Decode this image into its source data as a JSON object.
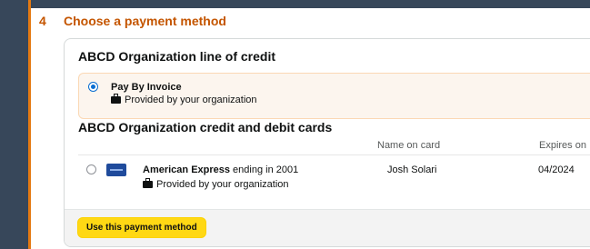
{
  "step": {
    "number": "4",
    "title": "Choose a payment method"
  },
  "line_of_credit": {
    "title": "ABCD Organization line of credit",
    "option_label": "Pay By Invoice",
    "provided_text": "Provided by your organization",
    "selected": true
  },
  "cards": {
    "title": "ABCD Organization credit and debit cards",
    "columns": {
      "name_header": "Name on card",
      "expires_header": "Expires on"
    },
    "items": [
      {
        "brand": "American Express",
        "ending_text": " ending in 2001",
        "provided_text": "Provided by your organization",
        "name_on_card": "Josh Solari",
        "expires": "04/2024",
        "selected": false
      }
    ]
  },
  "actions": {
    "use_button": "Use this payment method"
  },
  "colors": {
    "accent_orange": "#c45500",
    "button_yellow": "#ffd814",
    "selected_radio": "#0a6ed1",
    "highlight_bg": "#fcf5ee"
  },
  "icons": [
    "briefcase-icon",
    "card-icon"
  ]
}
